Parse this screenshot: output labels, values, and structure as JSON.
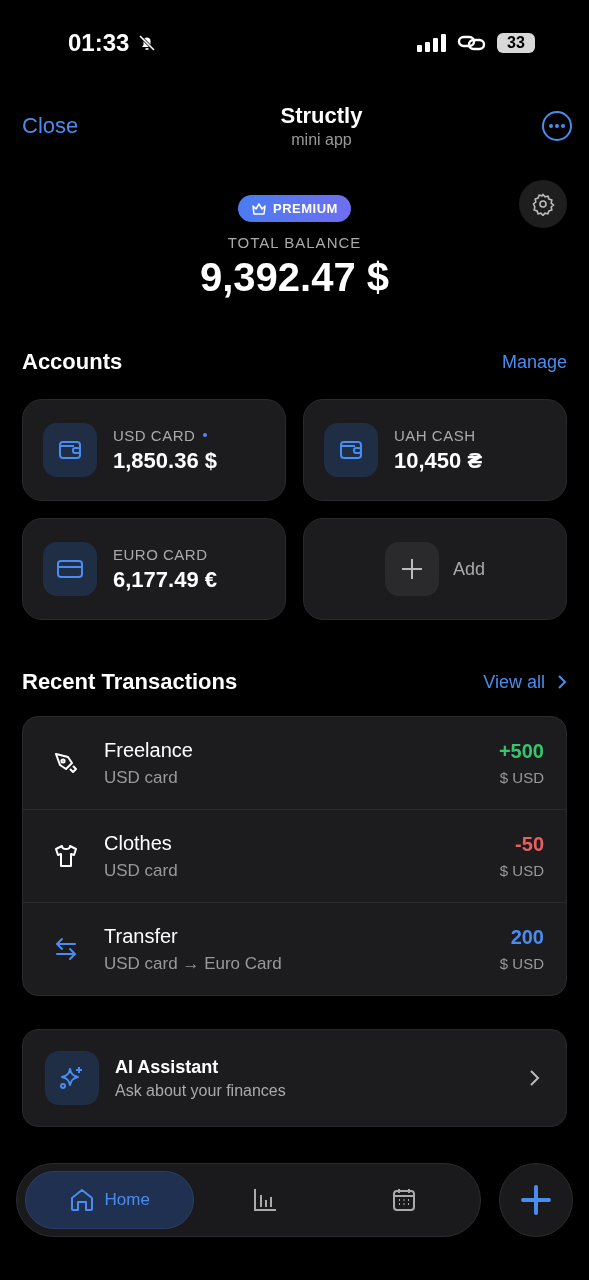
{
  "status_bar": {
    "time": "01:33",
    "battery": "33"
  },
  "header": {
    "close": "Close",
    "title": "Structly",
    "subtitle": "mini app"
  },
  "balance": {
    "badge": "PREMIUM",
    "label": "TOTAL BALANCE",
    "amount": "9,392.47 $"
  },
  "accounts": {
    "title": "Accounts",
    "manage": "Manage",
    "add": "Add",
    "items": [
      {
        "kind": "wallet",
        "name": "USD CARD",
        "amount": "1,850.36 $",
        "marked": true
      },
      {
        "kind": "wallet",
        "name": "UAH CASH",
        "amount": "10,450 ₴",
        "marked": false
      },
      {
        "kind": "card",
        "name": "EURO CARD",
        "amount": "6,177.49 €",
        "marked": false
      }
    ]
  },
  "transactions": {
    "title": "Recent Transactions",
    "view_all": "View all",
    "rows": [
      {
        "kind": "income",
        "title": "Freelance",
        "account": "USD card",
        "amount": "+500",
        "currency": "$ USD"
      },
      {
        "kind": "expense",
        "title": "Clothes",
        "account": "USD card",
        "amount": "-50",
        "currency": "$ USD"
      },
      {
        "kind": "transfer",
        "title": "Transfer",
        "account": "USD card → Euro Card",
        "amount": "200",
        "currency": "$ USD"
      }
    ]
  },
  "assistant": {
    "title": "AI Assistant",
    "subtitle": "Ask about your finances"
  },
  "nav": {
    "tabs": [
      {
        "kind": "home",
        "label": "Home",
        "selected": true
      },
      {
        "kind": "stats",
        "selected": false
      },
      {
        "kind": "calendar",
        "selected": false
      }
    ]
  }
}
